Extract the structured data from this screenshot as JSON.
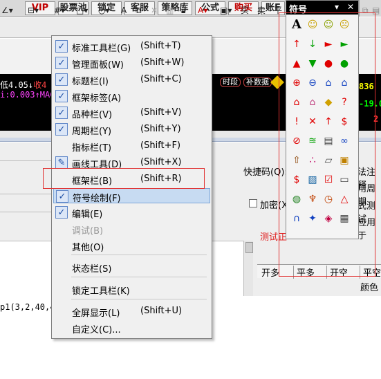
{
  "top_buttons": [
    "VIP",
    "股票池",
    "锁定",
    "客服",
    "策略库",
    "公式",
    "购买",
    "账F"
  ],
  "chart_panel": {
    "low_text": "低4.05↓",
    "collect_text": "收4",
    "value_line": "i:0.003↑MAC",
    "segment_tag": "时段",
    "fill_data_tag": "补数据",
    "right_value": "836",
    "right_value2": "-19.0",
    "right_value3": "2"
  },
  "right_labels": {
    "quick_code": "快捷码",
    "quick_code_key": "(Q):",
    "method_note": "法注释",
    "use_period": "用周期",
    "password": "加密",
    "password_key": "(X",
    "test_mode": "式测试",
    "apply_to": "应用于",
    "test_label": "测试正",
    "color_label": "颜色",
    "formula_line": "p1(3,2,40,4"
  },
  "bottom_tabs": [
    "开多",
    "平多",
    "开空",
    "平空"
  ],
  "menu": {
    "items": [
      {
        "label": "标准工具栏(G)",
        "shortcut": "(Shift+T)",
        "checked": true
      },
      {
        "label": "管理面板(W)",
        "shortcut": "(Shift+W)",
        "checked": true
      },
      {
        "label": "标题栏(I)",
        "shortcut": "(Shift+C)",
        "checked": true
      },
      {
        "label": "框架标签(A)",
        "shortcut": "",
        "checked": true
      },
      {
        "label": "品种栏(V)",
        "shortcut": "(Shift+V)",
        "checked": true
      },
      {
        "label": "周期栏(Y)",
        "shortcut": "(Shift+Y)",
        "checked": true
      },
      {
        "label": "指标栏(T)",
        "shortcut": "(Shift+F)",
        "checked": false
      },
      {
        "label": "画线工具(D)",
        "shortcut": "(Shift+X)",
        "checked": false,
        "pencil": true
      },
      {
        "label": "框架栏(B)",
        "shortcut": "(Shift+R)",
        "checked": false
      },
      {
        "label": "符号绘制(F)",
        "shortcut": "",
        "checked": true,
        "highlighted": true
      },
      {
        "label": "编辑(E)",
        "shortcut": "",
        "checked": true
      },
      {
        "label": "调试(B)",
        "shortcut": "",
        "checked": false,
        "disabled": true
      },
      {
        "label": "其他(O)",
        "shortcut": "",
        "checked": false
      },
      {
        "label": "状态栏(S)",
        "shortcut": "",
        "checked": false
      },
      {
        "label": "锁定工具栏(K)",
        "shortcut": "",
        "checked": false
      },
      {
        "label": "全屏显示(L)",
        "shortcut": "(Shift+U)",
        "checked": false
      },
      {
        "label": "自定义(C)...",
        "shortcut": "",
        "checked": false
      }
    ]
  },
  "symbol_panel": {
    "title": "符号",
    "dropdown": "▾",
    "close": "✕",
    "icons": [
      "letter-a-icon",
      "smiley-happy-icon",
      "smiley-neutral-icon",
      "smiley-sad-icon",
      "arrow-up-icon",
      "arrow-down-icon",
      "flag-right-icon",
      "flag-left-icon",
      "triangle-up-icon",
      "triangle-down-icon",
      "dot-red-icon",
      "dot-green-icon",
      "plus-circle-icon",
      "minus-circle-icon",
      "house-blue-icon",
      "house-outline-icon",
      "house-red-icon",
      "house-small-icon",
      "diamond-icon",
      "question-icon",
      "exclamation-icon",
      "cross-icon",
      "up-arrow-bar-icon",
      "dollar-icon",
      "no-sign-icon",
      "zigzag-icon",
      "document-icon",
      "binoculars-icon",
      "arrow-box-icon",
      "dots-icon",
      "layers-icon",
      "cube-icon",
      "dollar-small-icon",
      "image-icon",
      "check-box-icon",
      "eraser-icon",
      "globe-icon",
      "antenna-icon",
      "clock-icon",
      "warning-icon",
      "magnet-icon",
      "pin-icon",
      "gem-icon",
      "grid-icon"
    ]
  },
  "colors": {
    "highlight_box": "#e03030",
    "menu_highlight": "#c7dbf2",
    "check_border": "#5f86c8"
  }
}
